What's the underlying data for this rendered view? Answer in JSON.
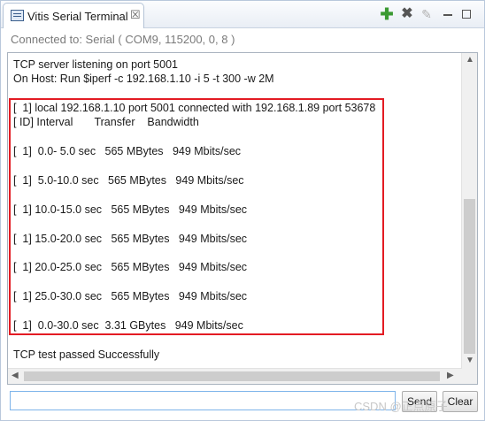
{
  "tab": {
    "title": "Vitis Serial Terminal",
    "close_glyph": "☒"
  },
  "toolbar": {
    "add_icon": "plus-icon",
    "remove_icon": "x-icon",
    "edit_icon": "pencil-icon",
    "minimize_icon": "minimize-icon",
    "maximize_icon": "maximize-icon"
  },
  "status": {
    "text": "Connected to: Serial (  COM9, 115200, 0, 8 )"
  },
  "console": {
    "lines": [
      "TCP server listening on port 5001",
      "On Host: Run $iperf -c 192.168.1.10 -i 5 -t 300 -w 2M",
      "[  1] local 192.168.1.10 port 5001 connected with 192.168.1.89 port 53678",
      "[ ID] Interval       Transfer    Bandwidth",
      "[  1]  0.0- 5.0 sec   565 MBytes   949 Mbits/sec",
      "[  1]  5.0-10.0 sec   565 MBytes   949 Mbits/sec",
      "[  1] 10.0-15.0 sec   565 MBytes   949 Mbits/sec",
      "[  1] 15.0-20.0 sec   565 MBytes   949 Mbits/sec",
      "[  1] 20.0-25.0 sec   565 MBytes   949 Mbits/sec",
      "[  1] 25.0-30.0 sec   565 MBytes   949 Mbits/sec",
      "[  1]  0.0-30.0 sec  3.31 GBytes   949 Mbits/sec",
      "TCP test passed Successfully"
    ]
  },
  "input": {
    "value": ""
  },
  "buttons": {
    "send": "Send",
    "clear": "Clear"
  },
  "watermark": "CSDN @正点原子",
  "colors": {
    "highlight": "#e31b23",
    "input_border": "#7eb4ea"
  }
}
